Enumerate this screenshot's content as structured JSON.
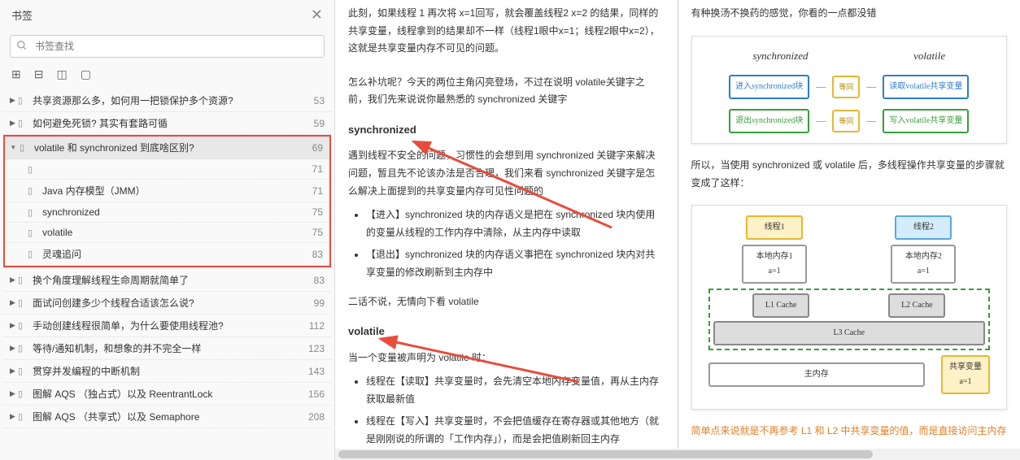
{
  "sidebar": {
    "title": "书签",
    "search_placeholder": "书签查找",
    "items": [
      {
        "label": "共享资源那么多，如何用一把锁保护多个资源?",
        "page": "53"
      },
      {
        "label": "如何避免死锁? 其实有套路可循",
        "page": "59"
      }
    ],
    "selected": {
      "label": "volatile 和 synchronized 到底啥区别?",
      "page": "69",
      "children": [
        {
          "label": "",
          "page": "71"
        },
        {
          "label": "Java 内存模型（JMM）",
          "page": "71"
        },
        {
          "label": "synchronized",
          "page": "75"
        },
        {
          "label": "volatile",
          "page": "75"
        },
        {
          "label": "灵魂追问",
          "page": "83"
        }
      ]
    },
    "after": [
      {
        "label": "换个角度理解线程生命周期就简单了",
        "page": "83"
      },
      {
        "label": "面试问创建多少个线程合适该怎么说?",
        "page": "99"
      },
      {
        "label": "手动创建线程很简单，为什么要使用线程池?",
        "page": "112"
      },
      {
        "label": "等待/通知机制，和想象的并不完全一样",
        "page": "123"
      },
      {
        "label": "贯穿并发编程的中断机制",
        "page": "143"
      },
      {
        "label": "图解 AQS （独占式）以及 ReentrantLock",
        "page": "156"
      },
      {
        "label": "图解 AQS （共享式）以及 Semaphore",
        "page": "208"
      }
    ]
  },
  "page1": {
    "p1": "此刻，如果线程 1 再次将 x=1回写，就会覆盖线程2 x=2 的结果，同样的共享变量，线程拿到的结果却不一样（线程1眼中x=1；线程2眼中x=2），这就是共享变量内存不可见的问题。",
    "p2": "怎么补坑呢？今天的两位主角闪亮登场，不过在说明 volatile关键字之前，我们先来说说你最熟悉的 synchronized 关键字",
    "h1": "synchronized",
    "p3": "遇到线程不安全的问题，习惯性的会想到用 synchronized 关键字来解决问题，暂且先不论该办法是否合理，我们来看 synchronized 关键字是怎么解决上面提到的共享变量内存可见性问题的",
    "li1": "【进入】synchronized 块的内存语义是把在 synchronized 块内使用的变量从线程的工作内存中清除，从主内存中读取",
    "li2": "【退出】synchronized 块的内存语义事把在 synchronized 块内对共享变量的修改刷新到主内存中",
    "p4": "二话不说，无情向下看 volatile",
    "h2": "volatile",
    "p5": "当一个变量被声明为 volatile 时：",
    "li3": "线程在【读取】共享变量时，会先清空本地内存变量值，再从主内存获取最新值",
    "li4": "线程在【写入】共享变量时，不会把值缓存在寄存器或其他地方（就是刚刚说的所谓的「工作内存」），而是会把值刷新回主内存"
  },
  "page2": {
    "p1": "有种换汤不换药的感觉，你看的一点都没错",
    "d1": {
      "col1": "synchronized",
      "col2": "volatile",
      "b1": "进入synchronized块",
      "b2": "读取volatile共享变量",
      "b3": "退出synchronized块",
      "b4": "写入volatile共享变量",
      "eq": "等同"
    },
    "p2": "所以，当使用 synchronized 或 volatile 后，多线程操作共享变量的步骤就变成了这样：",
    "d2": {
      "t1": "线程1",
      "t2": "线程2",
      "m1": "本地内存1\\na=1",
      "m2": "本地内存2\\na=1",
      "c1": "L1 Cache",
      "c2": "L2 Cache",
      "c3": "L3 Cache",
      "main": "主内存",
      "sh": "共享变量\\na=1"
    },
    "summary": "简单点来说就是不再参考 L1 和 L2 中共享变量的值，而是直接访问主内存"
  }
}
